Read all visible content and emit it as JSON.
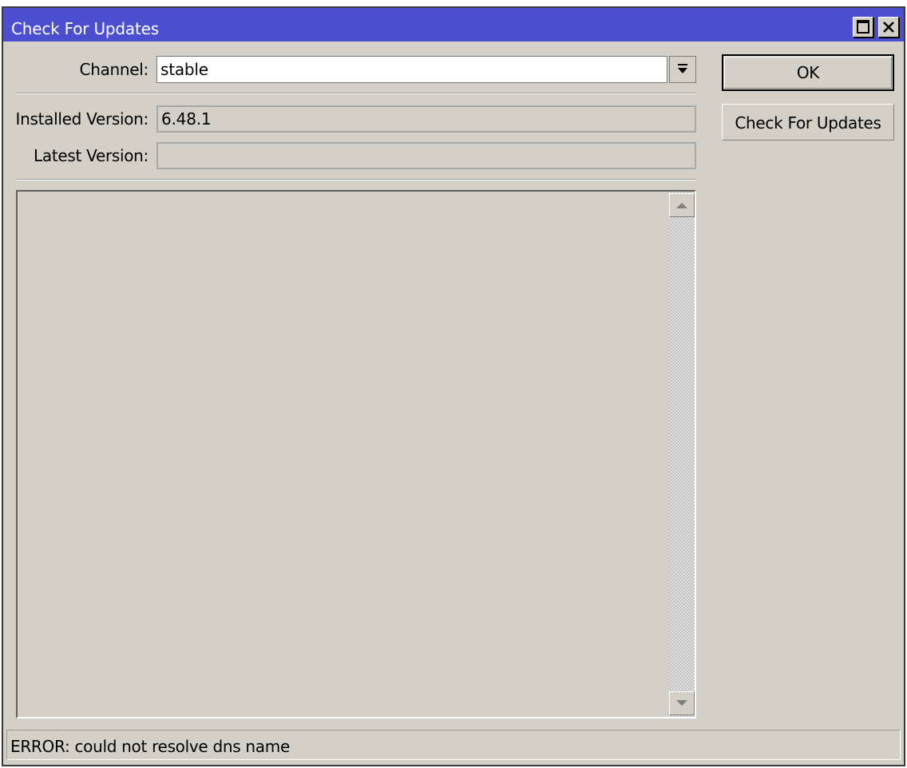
{
  "window": {
    "title": "Check For Updates",
    "maximize_icon": "maximize-icon",
    "close_icon": "close-icon"
  },
  "form": {
    "channel_label": "Channel:",
    "channel_value": "stable",
    "dropdown_icon": "dropdown-arrow-icon",
    "installed_label": "Installed Version:",
    "installed_value": "6.48.1",
    "latest_label": "Latest Version:",
    "latest_value": ""
  },
  "buttons": {
    "ok_label": "OK",
    "check_label": "Check For Updates"
  },
  "log": {
    "content": ""
  },
  "status": {
    "message": "ERROR: could not resolve dns name"
  },
  "colors": {
    "titlebar": "#4b4fcf",
    "face": "#d4d0c8"
  }
}
